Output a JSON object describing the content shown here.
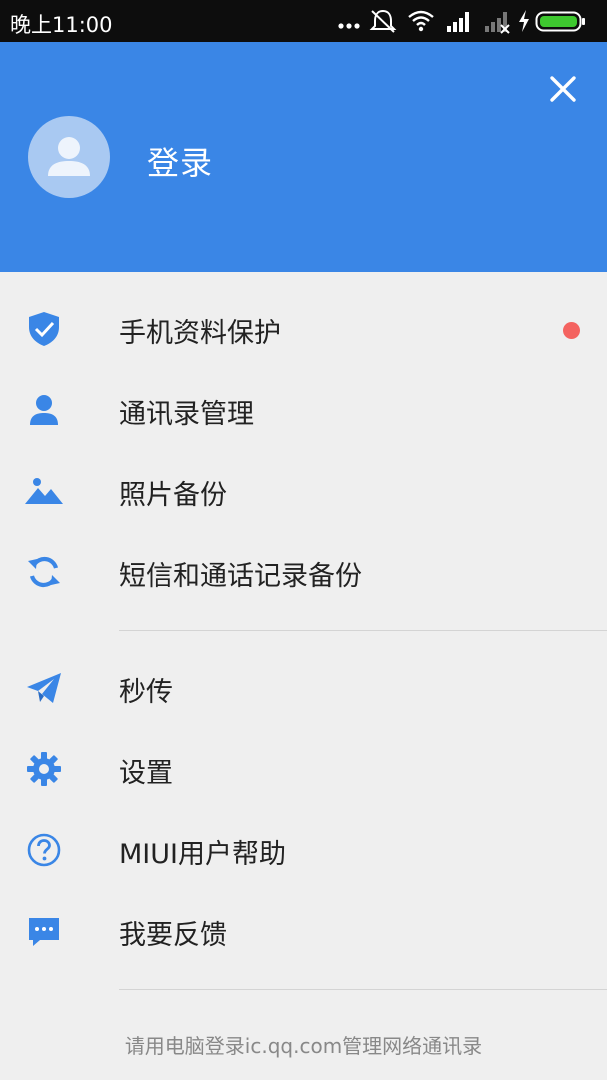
{
  "status_bar": {
    "time": "晚上11:00",
    "icons": [
      "more-dots-icon",
      "silent-vibrate-icon",
      "wifi-icon",
      "signal-icon",
      "signal-no-sim-icon",
      "charging-icon",
      "battery-icon"
    ]
  },
  "header": {
    "login_label": "登录",
    "background_color": "#3a86e6"
  },
  "menu": {
    "items": [
      {
        "label": "手机资料保护",
        "icon": "shield-check-icon",
        "has_badge": true
      },
      {
        "label": "通讯录管理",
        "icon": "person-icon"
      },
      {
        "label": "照片备份",
        "icon": "mountain-image-icon"
      },
      {
        "label": "短信和通话记录备份",
        "icon": "sync-icon"
      },
      {
        "label": "秒传",
        "icon": "paper-plane-icon"
      },
      {
        "label": "设置",
        "icon": "gear-icon"
      },
      {
        "label": "MIUI用户帮助",
        "icon": "help-circle-icon"
      },
      {
        "label": "我要反馈",
        "icon": "chat-bubble-icon"
      }
    ]
  },
  "footer": {
    "text": "请用电脑登录ic.qq.com管理网络通讯录"
  },
  "colors": {
    "accent": "#3a86e6",
    "badge": "#f46360"
  }
}
